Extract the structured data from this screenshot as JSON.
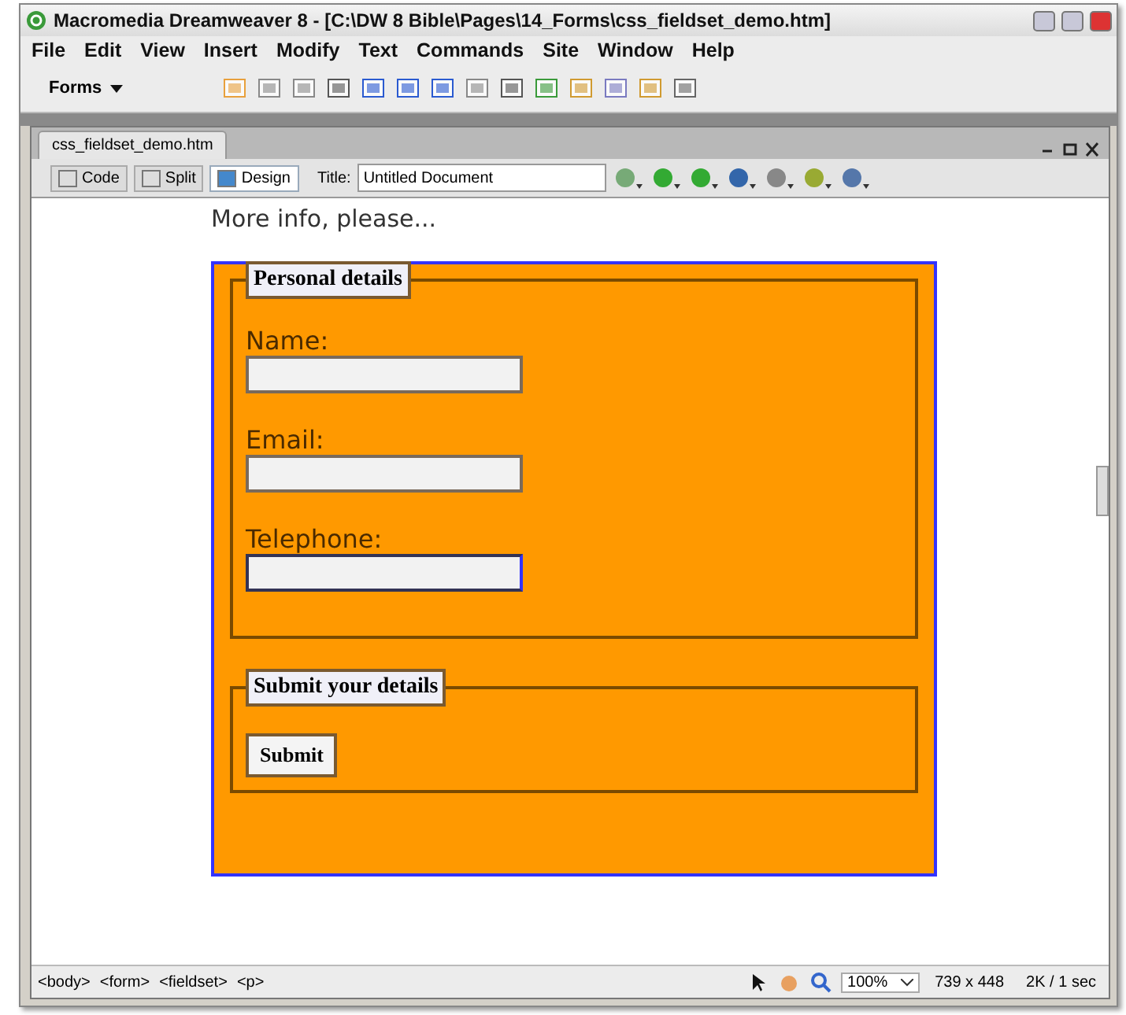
{
  "window": {
    "title": "Macromedia Dreamweaver 8 - [C:\\DW 8 Bible\\Pages\\14_Forms\\css_fieldset_demo.htm]"
  },
  "menu": [
    "File",
    "Edit",
    "View",
    "Insert",
    "Modify",
    "Text",
    "Commands",
    "Site",
    "Window",
    "Help"
  ],
  "insert_bar": {
    "category": "Forms"
  },
  "document": {
    "tab": "css_fieldset_demo.htm",
    "view_buttons": [
      {
        "label": "Code",
        "selected": false
      },
      {
        "label": "Split",
        "selected": false
      },
      {
        "label": "Design",
        "selected": true
      }
    ],
    "title_label": "Title:",
    "title_value": "Untitled Document"
  },
  "page": {
    "intro": "More info, please...",
    "fieldsets": [
      {
        "legend": "Personal details",
        "kind": "fields",
        "fields": [
          {
            "label": "Name:",
            "focused": false
          },
          {
            "label": "Email:",
            "focused": false
          },
          {
            "label": "Telephone:",
            "focused": true
          }
        ]
      },
      {
        "legend": "Submit your details",
        "kind": "submit",
        "button": "Submit"
      }
    ]
  },
  "status_bar": {
    "tags": [
      "<body>",
      "<form>",
      "<fieldset>",
      "<p>"
    ],
    "zoom": "100%",
    "size": "739 x 448",
    "download": "2K / 1 sec"
  }
}
